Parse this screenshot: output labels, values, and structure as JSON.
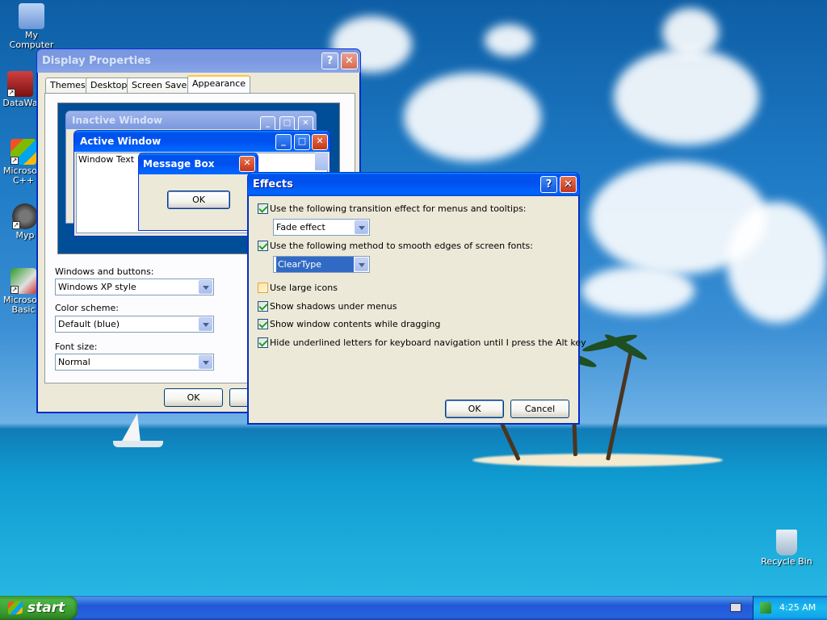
{
  "desktop": {
    "icons": [
      {
        "label": "My Computer"
      },
      {
        "label": "DataWa"
      },
      {
        "label": "Microsoft C++"
      },
      {
        "label": "Myp"
      },
      {
        "label": "Microsoft Basic"
      },
      {
        "label": "Recycle Bin"
      }
    ]
  },
  "display_properties": {
    "title": "Display Properties",
    "help": "?",
    "close": "✕",
    "tabs": [
      "Themes",
      "Desktop",
      "Screen Saver",
      "Appearance"
    ],
    "active_tab": "Appearance",
    "preview": {
      "inactive_title": "Inactive Window",
      "active_title": "Active Window",
      "window_text": "Window Text",
      "message_box_title": "Message Box",
      "ok": "OK"
    },
    "windows_buttons_label": "Windows and buttons:",
    "windows_buttons_value": "Windows XP style",
    "color_scheme_label": "Color scheme:",
    "color_scheme_value": "Default (blue)",
    "font_size_label": "Font size:",
    "font_size_value": "Normal",
    "ok": "OK"
  },
  "effects": {
    "title": "Effects",
    "help": "?",
    "close": "✕",
    "options": [
      {
        "label": "Use the following transition effect for menus and tooltips:",
        "checked": true
      },
      {
        "label": "Use the following method to smooth edges of screen fonts:",
        "checked": true
      },
      {
        "label": "Use large icons",
        "checked": false
      },
      {
        "label": "Show shadows under menus",
        "checked": true
      },
      {
        "label": "Show window contents while dragging",
        "checked": true
      },
      {
        "label": "Hide underlined letters for keyboard navigation until I press the Alt key",
        "checked": true
      }
    ],
    "transition_value": "Fade effect",
    "smoothing_value": "ClearType",
    "ok": "OK",
    "cancel": "Cancel"
  },
  "taskbar": {
    "start": "start",
    "clock": "4:25 AM"
  },
  "colors": {
    "title_blue": "#0058ee",
    "dialog_face": "#ece9d8",
    "start_green": "#3d9b35"
  }
}
